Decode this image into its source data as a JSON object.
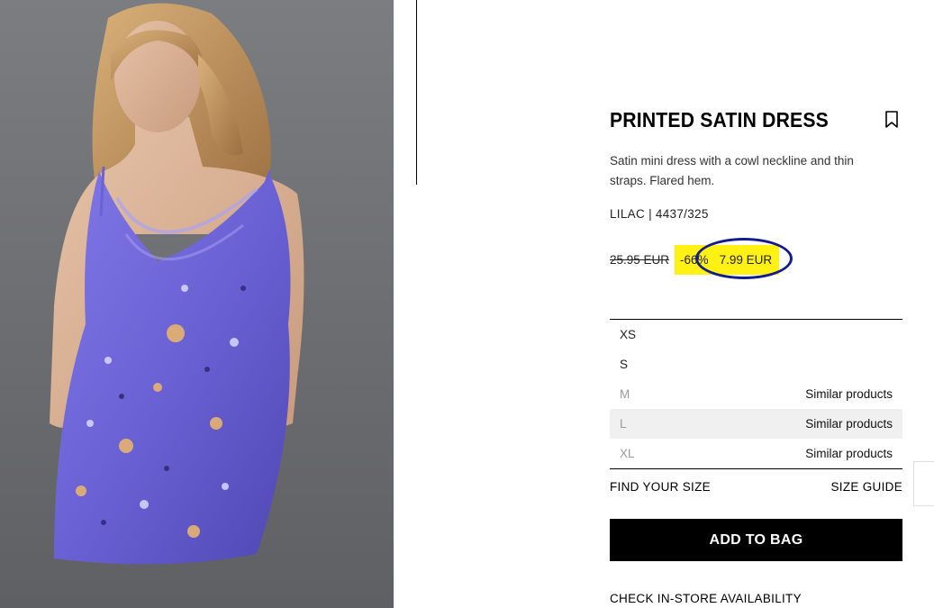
{
  "product": {
    "title": "PRINTED SATIN DRESS",
    "description": "Satin mini dress with a cowl neckline and thin straps. Flared hem.",
    "color_ref": "LILAC | 4437/325",
    "old_price": "25.95 EUR",
    "discount": "-66%",
    "new_price": "7.99 EUR",
    "image_icon": "model-photo"
  },
  "sizes": [
    {
      "size": "XS",
      "similar": "",
      "available": true
    },
    {
      "size": "S",
      "similar": "",
      "available": true
    },
    {
      "size": "M",
      "similar": "Similar products",
      "available": false
    },
    {
      "size": "L",
      "similar": "Similar products",
      "available": false
    },
    {
      "size": "XL",
      "similar": "Similar products",
      "available": false
    }
  ],
  "actions": {
    "find_size": "FIND YOUR SIZE",
    "size_guide": "SIZE GUIDE",
    "add_to_bag": "ADD TO BAG",
    "check_store": "CHECK IN-STORE AVAILABILITY"
  },
  "colors": {
    "discount_highlight": "#fff114",
    "annotation_circle": "#131c8f",
    "dress": "#6a62d4"
  }
}
